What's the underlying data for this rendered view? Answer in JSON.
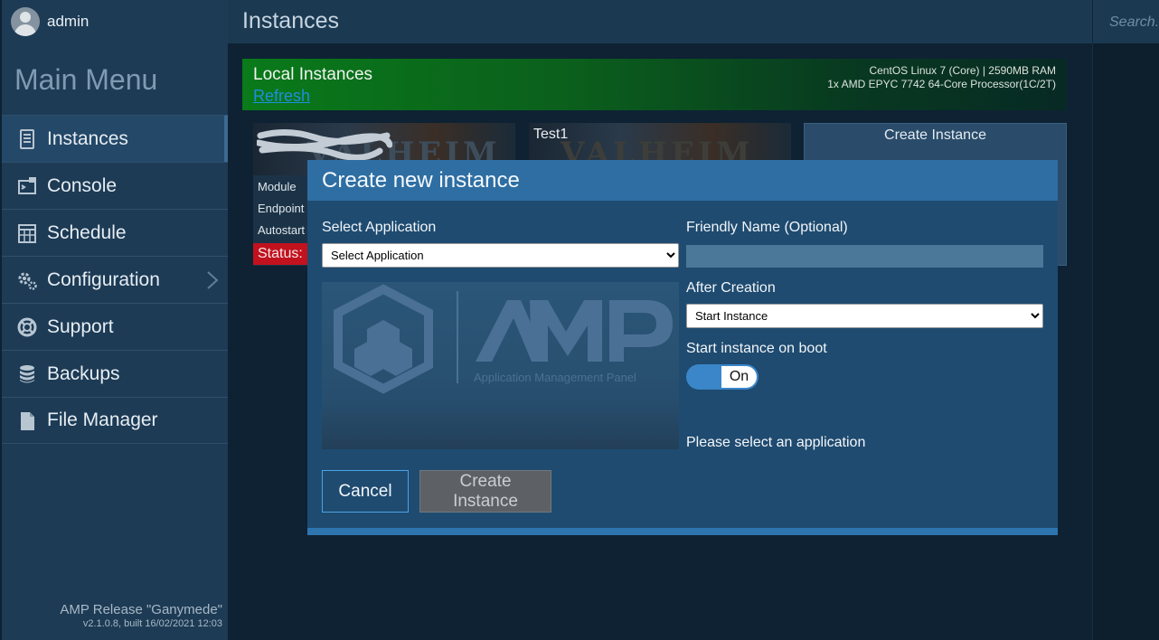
{
  "user": {
    "name": "admin"
  },
  "sidebar": {
    "title": "Main Menu",
    "items": [
      {
        "label": "Instances",
        "icon": "server-icon",
        "active": true
      },
      {
        "label": "Console",
        "icon": "console-icon"
      },
      {
        "label": "Schedule",
        "icon": "calendar-icon"
      },
      {
        "label": "Configuration",
        "icon": "gears-icon",
        "has_submenu": true
      },
      {
        "label": "Support",
        "icon": "lifebuoy-icon"
      },
      {
        "label": "Backups",
        "icon": "database-icon"
      },
      {
        "label": "File Manager",
        "icon": "file-icon"
      }
    ],
    "release": "AMP Release \"Ganymede\"",
    "build": "v2.1.0.8, built 16/02/2021 12:03"
  },
  "header": {
    "title": "Instances"
  },
  "search": {
    "placeholder": "Search..."
  },
  "local_instances": {
    "title": "Local Instances",
    "refresh": "Refresh",
    "info_line1": "CentOS Linux 7 (Core) | 2590MB RAM",
    "info_line2": "1x AMD EPYC 7742 64-Core Processor(1C/2T)"
  },
  "cards": {
    "card1": {
      "module": "Module",
      "endpoint": "Endpoint",
      "autostart": "Autostart",
      "status": "Status: C"
    },
    "card2": {
      "name": "Test1"
    },
    "create": {
      "label": "Create Instance"
    }
  },
  "modal": {
    "title": "Create new instance",
    "select_app_label": "Select Application",
    "select_app_value": "Select Application",
    "friendly_name_label": "Friendly Name (Optional)",
    "friendly_name_value": "",
    "after_creation_label": "After Creation",
    "after_creation_value": "Start Instance",
    "boot_label": "Start instance on boot",
    "boot_toggle": "On",
    "notice": "Please select an application",
    "cancel": "Cancel",
    "create": "Create Instance",
    "logo_text": "Application Management Panel"
  },
  "colors": {
    "accent": "#2e6ea3",
    "sidebar": "#1d3b55",
    "banner_green": "#0a7a1a",
    "status_red": "#c1121e"
  }
}
